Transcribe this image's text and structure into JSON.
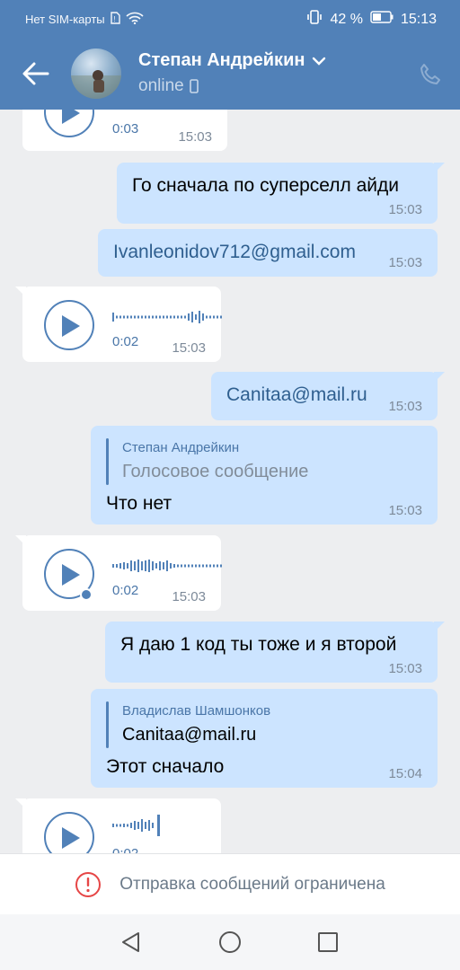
{
  "status_bar": {
    "carrier": "Нет SIM-карты",
    "battery": "42 %",
    "time": "15:13"
  },
  "header": {
    "contact_name": "Степан Андрейкин",
    "presence": "online"
  },
  "messages": [
    {
      "type": "voice_in",
      "duration": "0:03",
      "time": "15:03"
    },
    {
      "type": "text_out",
      "text": "Го сначала по суперселл айди",
      "time": "15:03"
    },
    {
      "type": "text_out",
      "text": "Ivanleonidov712@gmail.com",
      "time": "15:03"
    },
    {
      "type": "voice_in",
      "duration": "0:02",
      "time": "15:03"
    },
    {
      "type": "text_out",
      "text": "Canitaa@mail.ru",
      "time": "15:03"
    },
    {
      "type": "reply_out",
      "reply_author": "Степан Андрейкин",
      "reply_text": "Голосовое сообщение",
      "text": "Что нет",
      "time": "15:03"
    },
    {
      "type": "voice_in",
      "duration": "0:02",
      "time": "15:03"
    },
    {
      "type": "text_out",
      "text": "Я даю 1 код ты тоже и я второй",
      "time": "15:03"
    },
    {
      "type": "reply_out",
      "reply_author": "Владислав Шамшонков",
      "reply_text": "Canitaa@mail.ru",
      "text": "Этот сначало",
      "time": "15:04"
    },
    {
      "type": "voice_in",
      "duration": "0:02",
      "time": ""
    }
  ],
  "restriction_banner": {
    "text": "Отправка сообщений ограничена"
  },
  "colors": {
    "header": "#5181b8",
    "outgoing": "#cce4ff",
    "incoming": "#ffffff",
    "background": "#edeef0",
    "accent": "#4a76a8"
  },
  "icons": [
    "back-arrow-icon",
    "chevron-down-icon",
    "phone-icon",
    "play-icon",
    "error-icon",
    "nav-back-icon",
    "nav-home-icon",
    "nav-recents-icon"
  ]
}
